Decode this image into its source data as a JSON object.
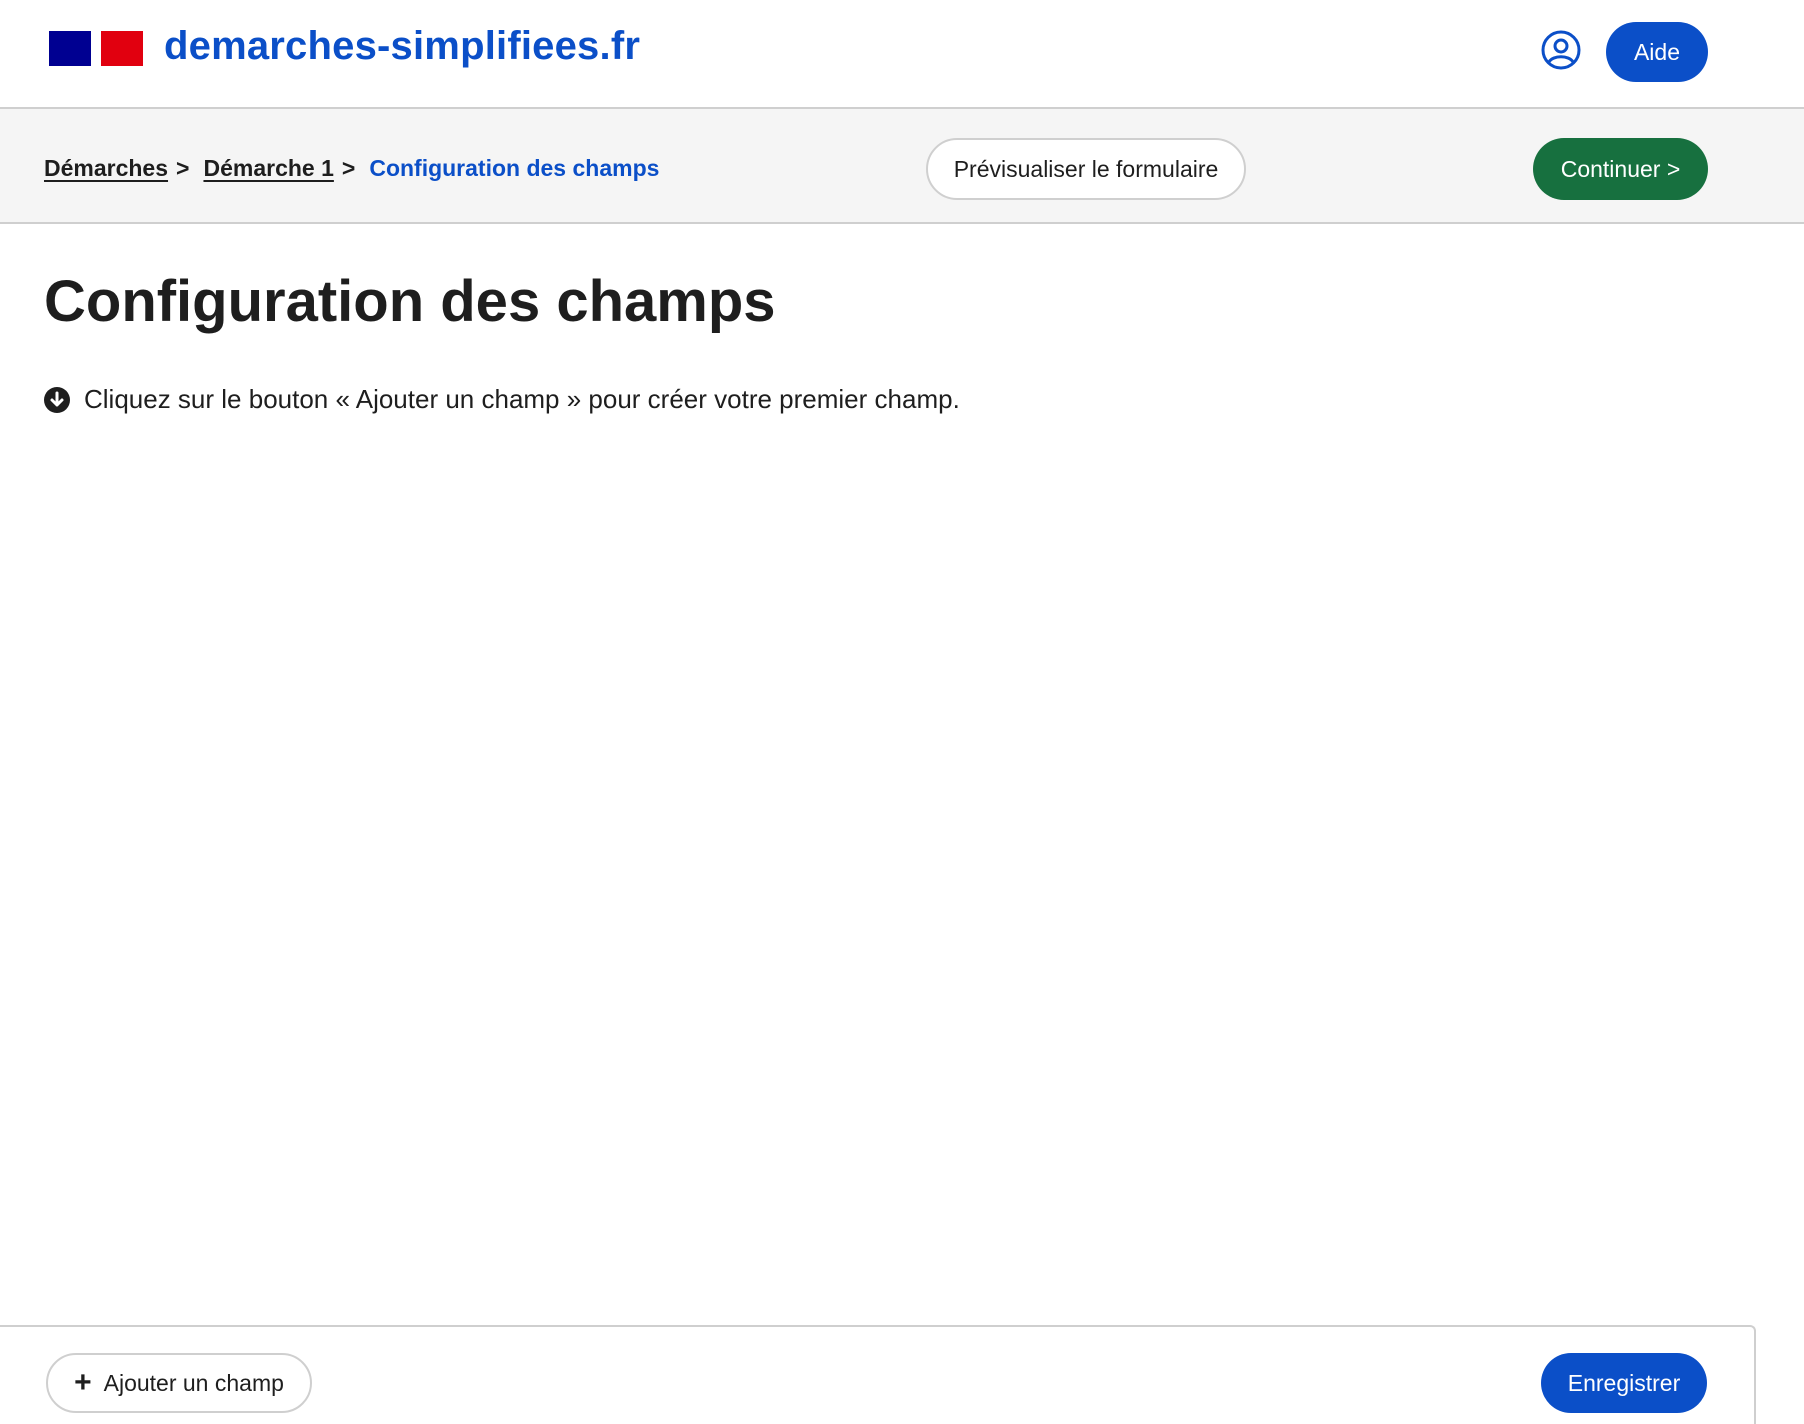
{
  "header": {
    "site_name": "demarches-simplifiees.fr",
    "help_label": "Aide",
    "user_icon": "user-circle-icon",
    "logo_icon": "marianne-flag-logo"
  },
  "breadcrumb": {
    "items": [
      "Démarches",
      "Démarche 1"
    ],
    "current": "Configuration des champs",
    "separator": ">"
  },
  "toolbar": {
    "preview_label": "Prévisualiser le formulaire",
    "continue_label": "Continuer >"
  },
  "main": {
    "title": "Configuration des champs",
    "hint_text": "Cliquez sur le bouton « Ajouter un champ » pour créer votre premier champ.",
    "hint_icon": "arrow-down-circle-icon"
  },
  "footer": {
    "add_field_label": "Ajouter un champ",
    "add_icon": "plus-icon",
    "save_label": "Enregistrer"
  },
  "colors": {
    "primary_blue": "#0b4fc8",
    "success_green": "#17703f",
    "flag_blue": "#000091",
    "flag_red": "#e1000f",
    "bar_gray": "#f5f5f5"
  }
}
